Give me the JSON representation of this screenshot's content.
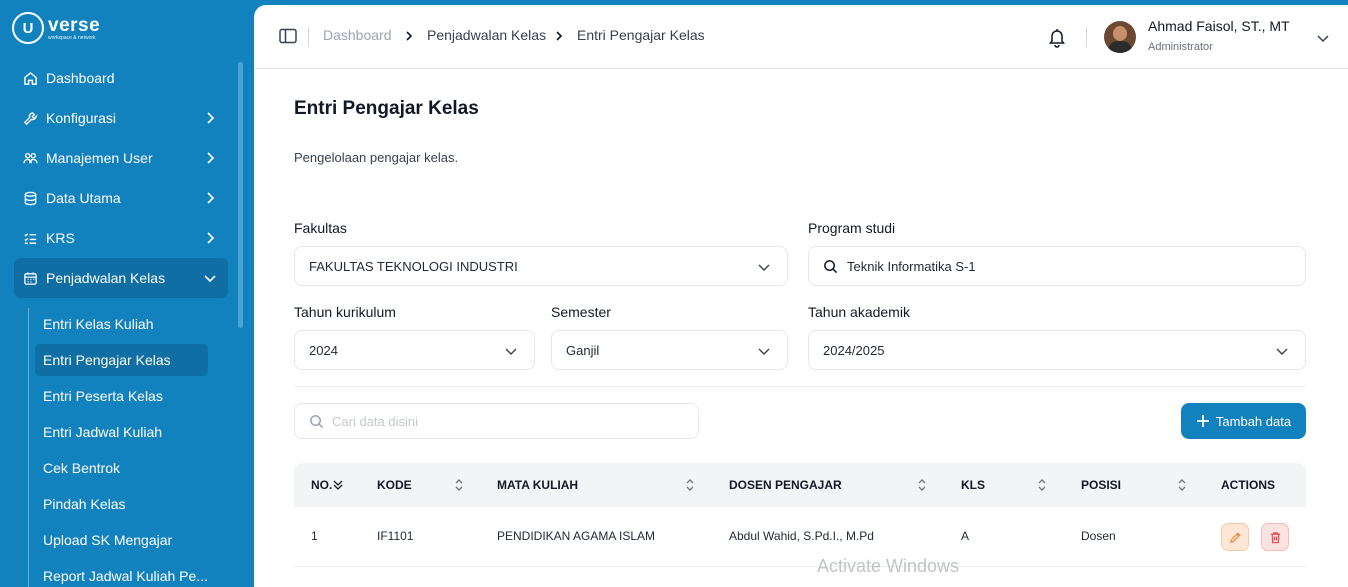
{
  "brand": {
    "mark": "U",
    "word": "verse",
    "tagline": "workspace & network"
  },
  "sidebar": {
    "items": [
      {
        "label": "Dashboard",
        "icon": "home-icon",
        "has_children": false
      },
      {
        "label": "Konfigurasi",
        "icon": "wrench-icon",
        "has_children": true
      },
      {
        "label": "Manajemen User",
        "icon": "users-icon",
        "has_children": true
      },
      {
        "label": "Data Utama",
        "icon": "database-icon",
        "has_children": true
      },
      {
        "label": "KRS",
        "icon": "list-icon",
        "has_children": true
      },
      {
        "label": "Penjadwalan Kelas",
        "icon": "calendar-icon",
        "has_children": true,
        "expanded": true
      }
    ],
    "subitems": [
      {
        "label": "Entri Kelas Kuliah"
      },
      {
        "label": "Entri Pengajar Kelas",
        "active": true
      },
      {
        "label": "Entri Peserta Kelas"
      },
      {
        "label": "Entri Jadwal Kuliah"
      },
      {
        "label": "Cek Bentrok"
      },
      {
        "label": "Pindah Kelas"
      },
      {
        "label": "Upload SK Mengajar"
      },
      {
        "label": "Report Jadwal Kuliah Pe..."
      }
    ]
  },
  "breadcrumb": [
    "Dashboard",
    "Penjadwalan Kelas",
    "Entri Pengajar Kelas"
  ],
  "user": {
    "name": "Ahmad Faisol, ST., MT",
    "role": "Administrator"
  },
  "page": {
    "title": "Entri Pengajar Kelas",
    "description": "Pengelolaan pengajar kelas."
  },
  "filters": {
    "fakultas": {
      "label": "Fakultas",
      "value": "FAKULTAS TEKNOLOGI INDUSTRI"
    },
    "program_studi": {
      "label": "Program studi",
      "value": "Teknik Informatika S-1"
    },
    "tahun_kurikulum": {
      "label": "Tahun kurikulum",
      "value": "2024"
    },
    "semester": {
      "label": "Semester",
      "value": "Ganjil"
    },
    "tahun_akademik": {
      "label": "Tahun akademik",
      "value": "2024/2025"
    }
  },
  "search": {
    "placeholder": "Cari data disini"
  },
  "add_button": {
    "label": "Tambah data"
  },
  "table": {
    "columns": [
      "NO.",
      "KODE",
      "MATA KULIAH",
      "DOSEN PENGAJAR",
      "KLS",
      "POSISI",
      "ACTIONS"
    ],
    "rows": [
      {
        "no": "1",
        "kode": "IF1101",
        "mata_kuliah": "PENDIDIKAN AGAMA ISLAM",
        "dosen": "Abdul Wahid, S.Pd.I., M.Pd",
        "kls": "A",
        "posisi": "Dosen"
      }
    ]
  },
  "watermark": "Activate Windows",
  "colors": {
    "primary": "#1282bf",
    "active_bg": "#0f6fa4",
    "edit": "#f59e6b",
    "delete": "#e05252"
  }
}
